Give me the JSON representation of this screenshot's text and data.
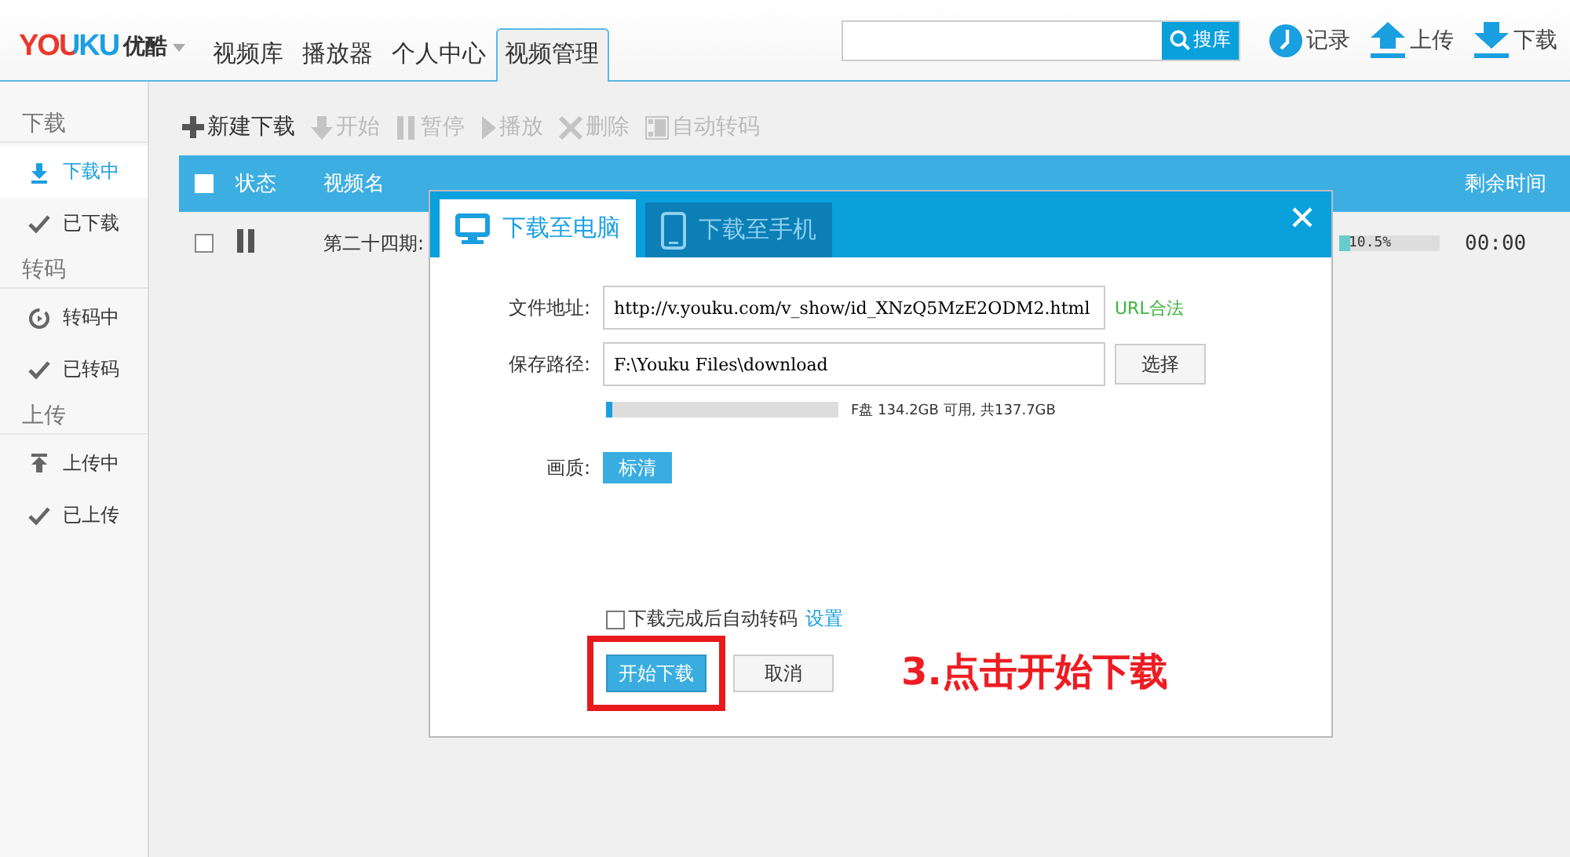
{
  "app": {
    "logo": "YOUKU",
    "logo_cn": "优酷",
    "nav": [
      {
        "label": "视频库",
        "selected": false
      },
      {
        "label": "播放器",
        "selected": false
      },
      {
        "label": "个人中心",
        "selected": false
      },
      {
        "label": "视频管理",
        "selected": true
      }
    ],
    "search": {
      "button": "搜库"
    },
    "actions": [
      {
        "kind": "history",
        "label": "记录"
      },
      {
        "kind": "upload",
        "label": "上传"
      },
      {
        "kind": "download",
        "label": "下载"
      }
    ]
  },
  "sidebar": {
    "groups": [
      {
        "title": "下载",
        "items": [
          {
            "kind": "download",
            "label": "下载中",
            "selected": true
          },
          {
            "kind": "check",
            "label": "已下载",
            "selected": false
          }
        ]
      },
      {
        "title": "转码",
        "items": [
          {
            "kind": "convert",
            "label": "转码中",
            "selected": false
          },
          {
            "kind": "check",
            "label": "已转码",
            "selected": false
          }
        ]
      },
      {
        "title": "上传",
        "items": [
          {
            "kind": "upload",
            "label": "上传中",
            "selected": false
          },
          {
            "kind": "check",
            "label": "已上传",
            "selected": false
          }
        ]
      }
    ]
  },
  "toolbar": [
    {
      "kind": "plus",
      "label": "新建下载",
      "disabled": false
    },
    {
      "kind": "down",
      "label": "开始",
      "disabled": true
    },
    {
      "kind": "pause",
      "label": "暂停",
      "disabled": true
    },
    {
      "kind": "play",
      "label": "播放",
      "disabled": true
    },
    {
      "kind": "delete",
      "label": "删除",
      "disabled": true
    },
    {
      "kind": "film",
      "label": "自动转码",
      "disabled": true
    }
  ],
  "table": {
    "header_checked": false,
    "columns": [
      "状态",
      "视频名",
      "剩余时间"
    ],
    "rows": [
      {
        "checked": false,
        "name": "第二十四期:",
        "progress": {
          "level": 0.105,
          "reading": "10.5%"
        },
        "remaining": "00:00"
      }
    ]
  },
  "dialog": {
    "tabs": [
      {
        "kind": "computer",
        "label": "下载至电脑",
        "selected": true
      },
      {
        "kind": "phone",
        "label": "下载至手机",
        "selected": false
      }
    ],
    "url": {
      "label": "文件地址:",
      "value": "http://v.youku.com/v_show/id_XNzQ5MzE2ODM2.html",
      "status": "URL合法"
    },
    "path": {
      "label": "保存路径:",
      "value": "F:\\Youku Files\\download",
      "button": "选择"
    },
    "disk": {
      "level": 0.025,
      "reading": "F盘 134.2GB 可用, 共137.7GB"
    },
    "quality": {
      "label": "画质:",
      "option": "标清"
    },
    "auto_transcode": {
      "checked": false,
      "label": "下载完成后自动转码",
      "link": "设置"
    },
    "buttons": [
      {
        "kind": "primary",
        "label": "开始下载"
      },
      {
        "kind": "secondary",
        "label": "取消"
      }
    ],
    "annotation": "3.点击开始下载"
  }
}
